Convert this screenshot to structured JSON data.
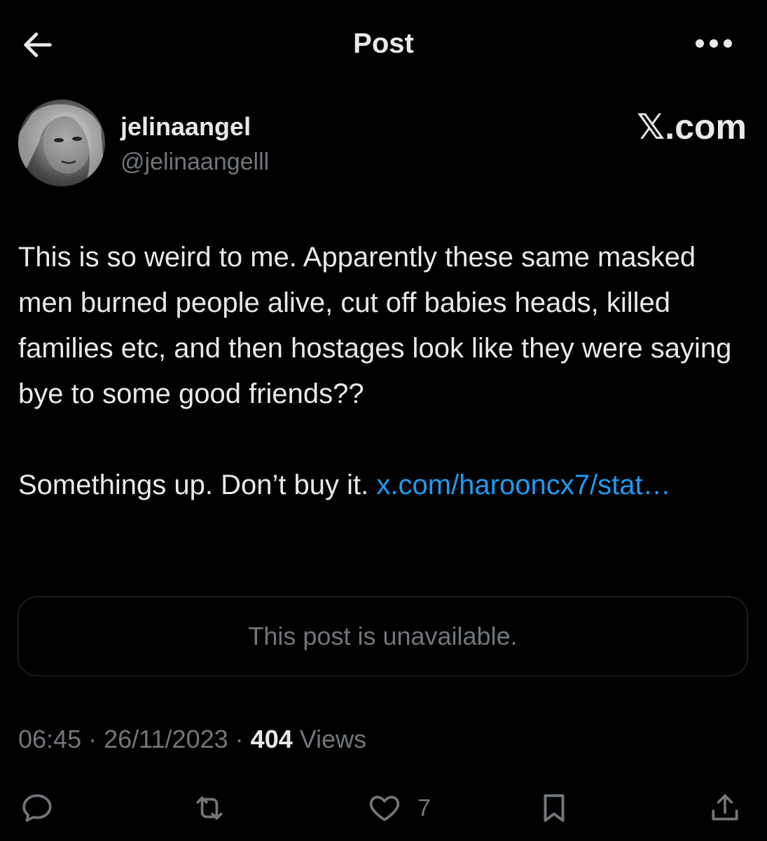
{
  "header": {
    "title": "Post",
    "back_icon": "arrow-left-icon",
    "more_icon": "more-horizontal-icon"
  },
  "author": {
    "display_name": "jelinaangel",
    "handle": "@jelinaangelll",
    "watermark": "𝕏.com"
  },
  "post": {
    "paragraph1": "This is so weird to me. Apparently these same masked men burned people alive, cut off babies heads, killed families etc, and then hostages look like they were saying bye to some good friends??",
    "paragraph2_text": "Somethings up. Don’t buy it. ",
    "paragraph2_link": "x.com/harooncx7/stat…",
    "quoted_post": "This post is unavailable."
  },
  "meta": {
    "time": "06:45",
    "date": "26/11/2023",
    "views_count": "404",
    "views_label": "Views",
    "separator": "·"
  },
  "actions": {
    "reply_icon": "reply-icon",
    "repost_icon": "repost-icon",
    "like_icon": "heart-icon",
    "like_count": "7",
    "bookmark_icon": "bookmark-icon",
    "share_icon": "share-icon"
  },
  "colors": {
    "background": "#000000",
    "text": "#e7e9ea",
    "secondary": "#71767b",
    "link": "#1d9bf0",
    "border": "#2f3336"
  }
}
